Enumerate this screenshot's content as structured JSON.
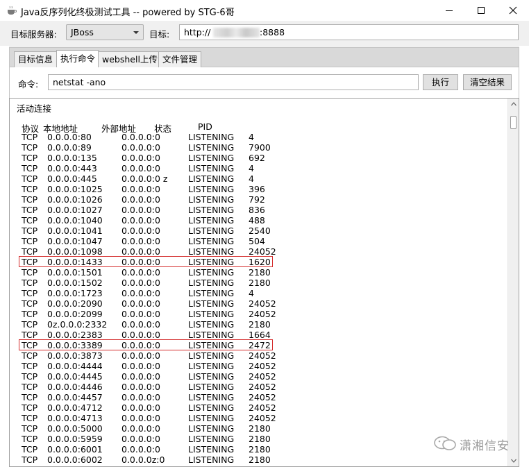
{
  "window": {
    "title": "Java反序列化终极测试工具  -- powered by STG-6哥",
    "controls": [
      "minimize",
      "maximize",
      "close"
    ]
  },
  "server_row": {
    "server_label": "目标服务器:",
    "server_value": "JBoss",
    "target_label": "目标:",
    "target_prefix": "http://",
    "target_suffix": ":8888"
  },
  "tabs": [
    {
      "label": "目标信息",
      "active": false
    },
    {
      "label": "执行命令",
      "active": true
    },
    {
      "label": "webshell上传",
      "active": false
    },
    {
      "label": "文件管理",
      "active": false
    }
  ],
  "command": {
    "label": "命令:",
    "value": "netstat -ano",
    "execute_label": "执行",
    "clear_label": "清空结果"
  },
  "result": {
    "heading": "活动连接",
    "columns": [
      "协议",
      "本地地址",
      "外部地址",
      "状态",
      "PID"
    ],
    "rows": [
      {
        "proto": "TCP",
        "local": "0.0.0.0:80",
        "foreign": "0.0.0.0:0",
        "state": "LISTENING",
        "pid": "4"
      },
      {
        "proto": "TCP",
        "local": "0.0.0.0:89",
        "foreign": "0.0.0.0:0",
        "state": "LISTENING",
        "pid": "7900"
      },
      {
        "proto": "TCP",
        "local": "0.0.0.0:135",
        "foreign": "0.0.0.0:0",
        "state": "LISTENING",
        "pid": "692"
      },
      {
        "proto": "TCP",
        "local": "0.0.0.0:443",
        "foreign": "0.0.0.0:0",
        "state": "LISTENING",
        "pid": "4"
      },
      {
        "proto": "TCP",
        "local": "0.0.0.0:445",
        "foreign": "0.0.0.0:0 z",
        "state": "LISTENING",
        "pid": "4"
      },
      {
        "proto": "TCP",
        "local": "0.0.0.0:1025",
        "foreign": "0.0.0.0:0",
        "state": "LISTENING",
        "pid": "396"
      },
      {
        "proto": "TCP",
        "local": "0.0.0.0:1026",
        "foreign": "0.0.0.0:0",
        "state": "LISTENING",
        "pid": "792"
      },
      {
        "proto": "TCP",
        "local": "0.0.0.0:1027",
        "foreign": "0.0.0.0:0",
        "state": "LISTENING",
        "pid": "836"
      },
      {
        "proto": "TCP",
        "local": "0.0.0.0:1040",
        "foreign": "0.0.0.0:0",
        "state": "LISTENING",
        "pid": "488"
      },
      {
        "proto": "TCP",
        "local": "0.0.0.0:1041",
        "foreign": "0.0.0.0:0",
        "state": "LISTENING",
        "pid": "2540"
      },
      {
        "proto": "TCP",
        "local": "0.0.0.0:1047",
        "foreign": "0.0.0.0:0",
        "state": "LISTENING",
        "pid": "504"
      },
      {
        "proto": "TCP",
        "local": "0.0.0.0:1098",
        "foreign": "0.0.0.0:0",
        "state": "LISTENING",
        "pid": "24052"
      },
      {
        "proto": "TCP",
        "local": "0.0.0.0:1433",
        "foreign": "0.0.0.0:0",
        "state": "LISTENING",
        "pid": "1620",
        "highlighted": true
      },
      {
        "proto": "TCP",
        "local": "0.0.0.0:1501",
        "foreign": "0.0.0.0:0",
        "state": "LISTENING",
        "pid": "2180"
      },
      {
        "proto": "TCP",
        "local": "0.0.0.0:1502",
        "foreign": "0.0.0.0:0",
        "state": "LISTENING",
        "pid": "2180"
      },
      {
        "proto": "TCP",
        "local": "0.0.0.0:1723",
        "foreign": "0.0.0.0:0",
        "state": "LISTENING",
        "pid": "4"
      },
      {
        "proto": "TCP",
        "local": "0.0.0.0:2090",
        "foreign": "0.0.0.0:0",
        "state": "LISTENING",
        "pid": "24052"
      },
      {
        "proto": "TCP",
        "local": "0.0.0.0:2099",
        "foreign": "0.0.0.0:0",
        "state": "LISTENING",
        "pid": "24052"
      },
      {
        "proto": "TCP",
        "local": "0z.0.0.0:2332",
        "foreign": "0.0.0.0:0",
        "state": "LISTENING",
        "pid": "2180"
      },
      {
        "proto": "TCP",
        "local": "0.0.0.0:2383",
        "foreign": "0.0.0.0:0",
        "state": "LISTENING",
        "pid": "1664"
      },
      {
        "proto": "TCP",
        "local": "0.0.0.0:3389",
        "foreign": "0.0.0.0:0",
        "state": "LISTENING",
        "pid": "2472",
        "highlighted": true
      },
      {
        "proto": "TCP",
        "local": "0.0.0.0:3873",
        "foreign": "0.0.0.0:0",
        "state": "LISTENING",
        "pid": "24052"
      },
      {
        "proto": "TCP",
        "local": "0.0.0.0:4444",
        "foreign": "0.0.0.0:0",
        "state": "LISTENING",
        "pid": "24052"
      },
      {
        "proto": "TCP",
        "local": "0.0.0.0:4445",
        "foreign": "0.0.0.0:0",
        "state": "LISTENING",
        "pid": "24052"
      },
      {
        "proto": "TCP",
        "local": "0.0.0.0:4446",
        "foreign": "0.0.0.0:0",
        "state": "LISTENING",
        "pid": "24052"
      },
      {
        "proto": "TCP",
        "local": "0.0.0.0:4457",
        "foreign": "0.0.0.0:0",
        "state": "LISTENING",
        "pid": "24052"
      },
      {
        "proto": "TCP",
        "local": "0.0.0.0:4712",
        "foreign": "0.0.0.0:0",
        "state": "LISTENING",
        "pid": "24052"
      },
      {
        "proto": "TCP",
        "local": "0.0.0.0:4713",
        "foreign": "0.0.0.0:0",
        "state": "LISTENING",
        "pid": "24052"
      },
      {
        "proto": "TCP",
        "local": "0.0.0.0:5000",
        "foreign": "0.0.0.0:0",
        "state": "LISTENING",
        "pid": "2180"
      },
      {
        "proto": "TCP",
        "local": "0.0.0.0:5959",
        "foreign": "0.0.0.0:0",
        "state": "LISTENING",
        "pid": "2180"
      },
      {
        "proto": "TCP",
        "local": "0.0.0.0:6001",
        "foreign": "0.0.0.0:0",
        "state": "LISTENING",
        "pid": "2180"
      },
      {
        "proto": "TCP",
        "local": "0.0.0.0:6002",
        "foreign": "0.0.0.0z:0",
        "state": "LISTENING",
        "pid": "2180"
      }
    ]
  },
  "watermark": {
    "text": "潇湘信安"
  },
  "colors": {
    "highlight_box": "#d42b2b",
    "window_bg": "#f0f0f0"
  }
}
